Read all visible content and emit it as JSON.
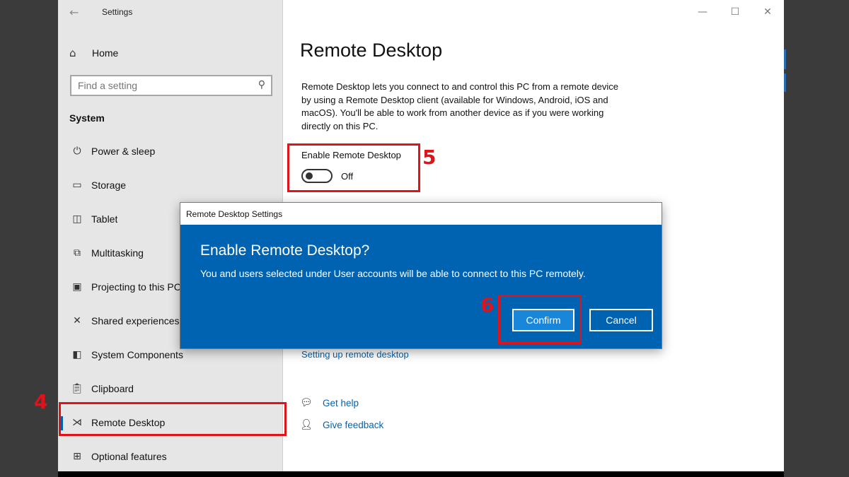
{
  "window": {
    "title": "Settings",
    "controls": {
      "minimize": "—",
      "maximize": "☐",
      "close": "✕"
    }
  },
  "sidebar": {
    "home_label": "Home",
    "search_placeholder": "Find a setting",
    "section_header": "System",
    "items": [
      {
        "label": "Power & sleep",
        "icon": "power-icon"
      },
      {
        "label": "Storage",
        "icon": "storage-icon"
      },
      {
        "label": "Tablet",
        "icon": "tablet-icon"
      },
      {
        "label": "Multitasking",
        "icon": "multitasking-icon"
      },
      {
        "label": "Projecting to this PC",
        "icon": "projecting-icon"
      },
      {
        "label": "Shared experiences",
        "icon": "shared-icon"
      },
      {
        "label": "System Components",
        "icon": "components-icon"
      },
      {
        "label": "Clipboard",
        "icon": "clipboard-icon"
      },
      {
        "label": "Remote Desktop",
        "icon": "remote-desktop-icon",
        "selected": true
      },
      {
        "label": "Optional features",
        "icon": "optional-features-icon"
      }
    ]
  },
  "main": {
    "title": "Remote Desktop",
    "description": "Remote Desktop lets you connect to and control this PC from a remote device by using a Remote Desktop client (available for Windows, Android, iOS and macOS). You'll be able to work from another device as if you were working directly on this PC.",
    "enable_label": "Enable Remote Desktop",
    "toggle_state": "Off",
    "setup_link": "Setting up remote desktop",
    "get_help": "Get help",
    "give_feedback": "Give feedback"
  },
  "dialog": {
    "window_title": "Remote Desktop Settings",
    "heading": "Enable Remote Desktop?",
    "message": "You and users selected under User accounts will be able to connect to this PC remotely.",
    "confirm_label": "Confirm",
    "cancel_label": "Cancel"
  },
  "annotations": {
    "step4": "4",
    "step5": "5",
    "step6": "6"
  },
  "colors": {
    "accent": "#0063b1",
    "annotation": "#e0121a"
  }
}
